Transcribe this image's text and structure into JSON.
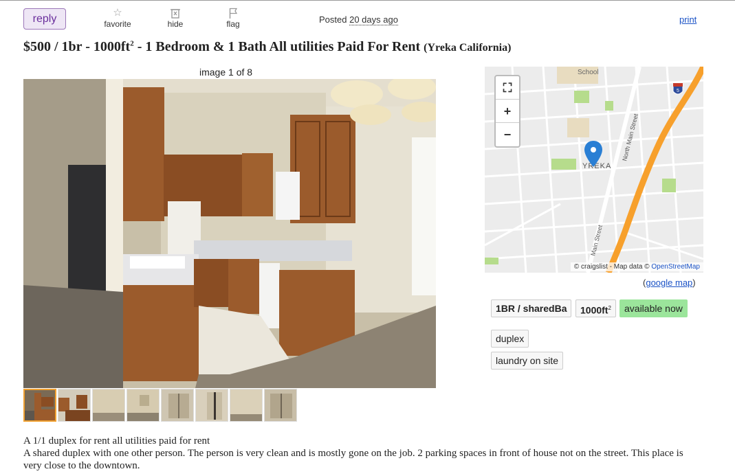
{
  "actions": {
    "reply": "reply",
    "favorite": "favorite",
    "hide": "hide",
    "flag": "flag",
    "print": "print"
  },
  "posted": {
    "prefix": "Posted",
    "ago": "20 days ago"
  },
  "title": {
    "price": "$500",
    "housing": "/ 1br - 1000ft",
    "sqft_sup": "2",
    "text": "- 1 Bedroom & 1 Bath All utilities Paid For Rent",
    "location": "(Yreka California)"
  },
  "gallery": {
    "counter": "image 1 of 8",
    "thumbnails": [
      {
        "label": "kitchen"
      },
      {
        "label": "kitchen-2"
      },
      {
        "label": "room"
      },
      {
        "label": "room-window"
      },
      {
        "label": "closet"
      },
      {
        "label": "closet-2"
      },
      {
        "label": "room-3"
      },
      {
        "label": "closet-3"
      }
    ]
  },
  "map": {
    "labels": {
      "school": "School",
      "city": "YREKA",
      "north_main": "North Main Street",
      "main": "Main Street",
      "interstate": "5"
    },
    "attribution": {
      "prefix": "© craigslist - Map data ©",
      "osm": "OpenStreetMap"
    },
    "google_map": "google map",
    "zoom_controls": [
      "fullscreen-icon",
      "zoom-in-icon",
      "zoom-out-icon"
    ],
    "colors": {
      "highway": "#f7a02c",
      "pin": "#2a7fd4",
      "park": "#b6dc8c"
    }
  },
  "attributes": {
    "bed_bath": "1BR / sharedBa",
    "sqft": "1000ft",
    "sqft_sup": "2",
    "availability": "available now",
    "tags": [
      "duplex",
      "laundry on site"
    ]
  },
  "description": {
    "line1": "A 1/1 duplex for rent all utilities paid for rent",
    "line2": "A shared duplex with one other person. The person is very clean and is mostly gone on the job. 2 parking spaces in front of house not on the street. This place is very close to the downtown."
  }
}
